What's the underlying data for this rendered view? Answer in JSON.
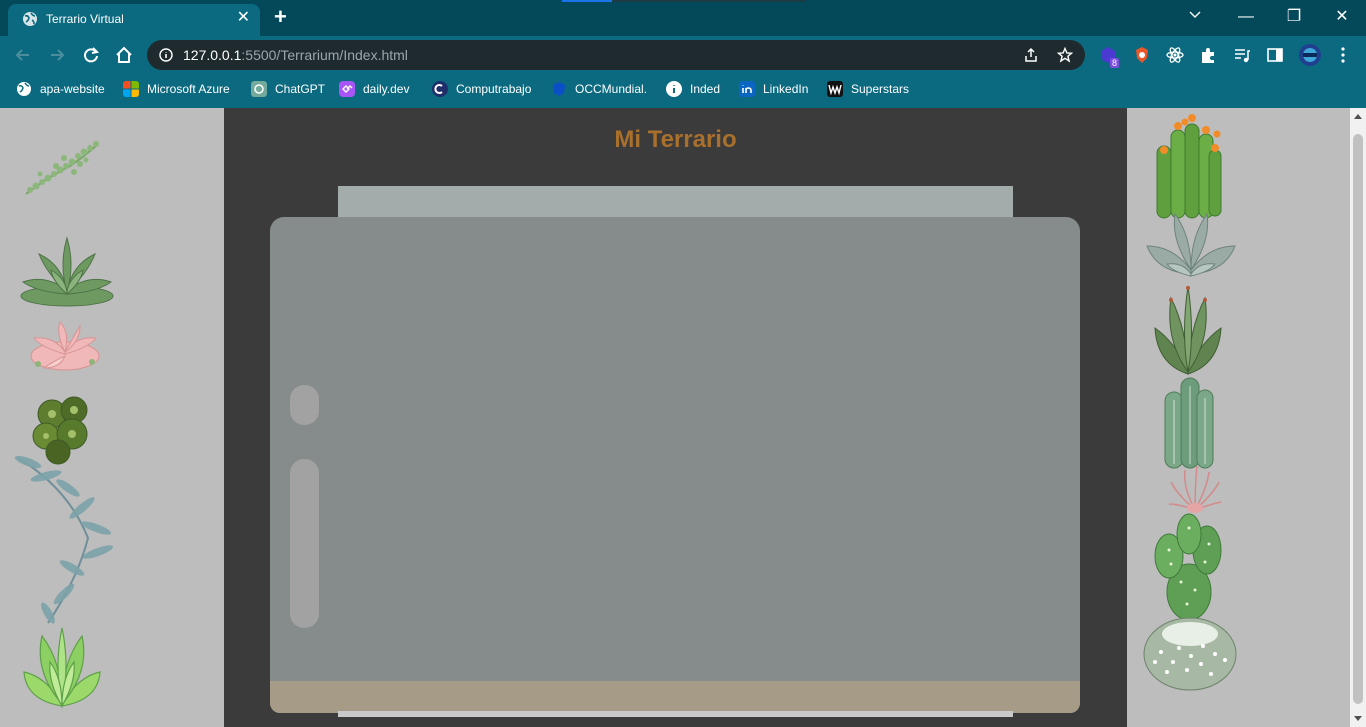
{
  "browser": {
    "tab": {
      "title": "Terrario Virtual",
      "close": "✕"
    },
    "new_tab": "+",
    "window": {
      "minimize": "—",
      "restore": "❐",
      "close": "✕"
    },
    "url_host": "127.0.0.1",
    "url_path": ":5500/Terrarium/Index.html",
    "extension_badge": "8",
    "bookmarks": [
      {
        "label": "apa-website",
        "icon": "globe-icon",
        "color": "#ffffff"
      },
      {
        "label": "Microsoft Azure",
        "icon": "microsoft-icon",
        "color": "#f25022"
      },
      {
        "label": "ChatGPT",
        "icon": "chatgpt-icon",
        "color": "#74aa9c"
      },
      {
        "label": "daily.dev",
        "icon": "dailydev-icon",
        "color": "#a855f7"
      },
      {
        "label": "Computrabajo",
        "icon": "computrabajo-icon",
        "color": "#1f2d6b"
      },
      {
        "label": "OCCMundial.",
        "icon": "occ-icon",
        "color": "#0b4fc8"
      },
      {
        "label": "Inded",
        "icon": "info-icon",
        "color": "#ffffff"
      },
      {
        "label": "LinkedIn",
        "icon": "linkedin-icon",
        "color": "#0a66c2"
      },
      {
        "label": "Superstars",
        "icon": "wwe-icon",
        "color": "#111111"
      }
    ]
  },
  "page": {
    "title": "Mi Terrario",
    "colors": {
      "title": "#a86f2d",
      "background": "#3b3b3b",
      "columns": "#bdbdbd",
      "jar": "#858c8b",
      "dirt": "#a69b86"
    },
    "plants_left": [
      "plant1",
      "plant2",
      "plant3",
      "plant4",
      "plant5",
      "plant6",
      "plant7"
    ],
    "plants_right": [
      "plant8",
      "plant9",
      "plant10",
      "plant11",
      "plant12",
      "plant13",
      "plant14"
    ]
  }
}
